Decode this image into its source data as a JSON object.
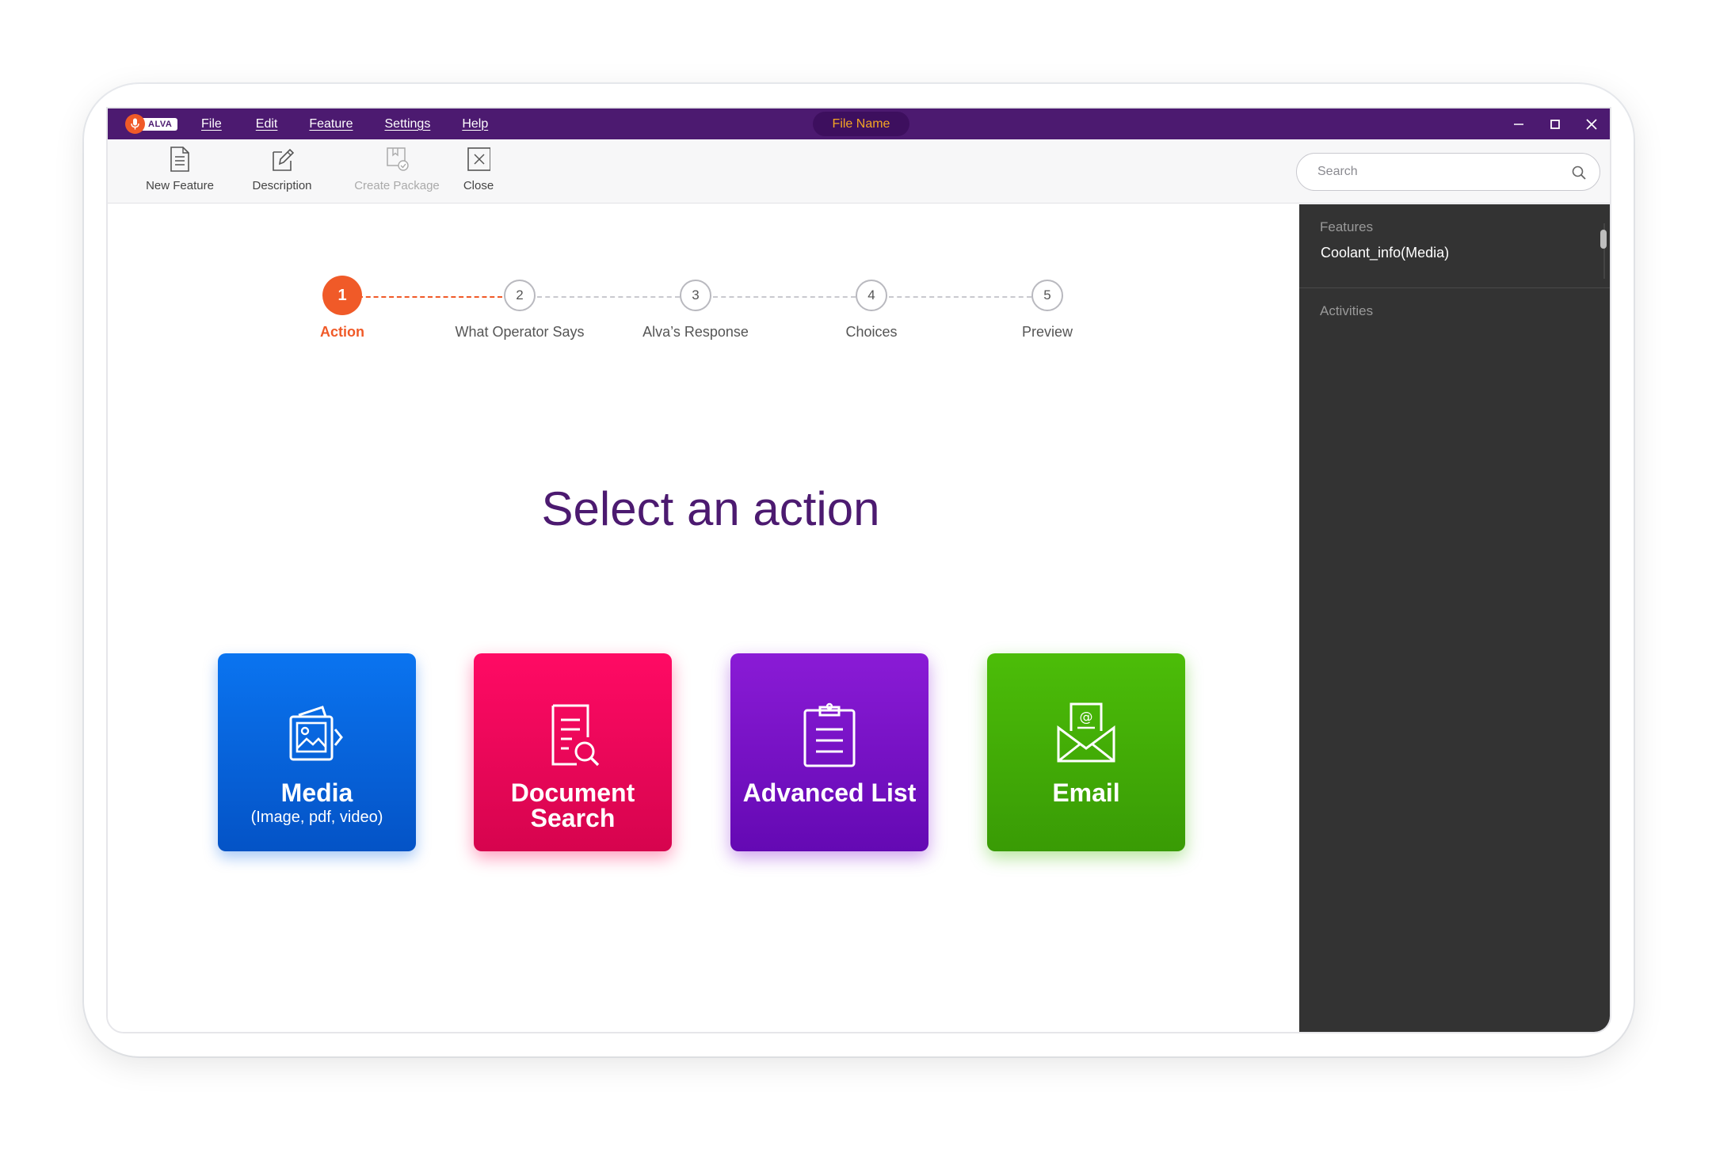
{
  "app": {
    "brand": "ALVA",
    "file_name": "File Name"
  },
  "menu": [
    "File",
    "Edit",
    "Feature",
    "Settings",
    "Help"
  ],
  "toolbar": {
    "new_feature": "New Feature",
    "description": "Description",
    "create_package": "Create Package",
    "close": "Close"
  },
  "search": {
    "placeholder": "Search"
  },
  "sidebar": {
    "features_heading": "Features",
    "feature_item": "Coolant_info(Media)",
    "activities_heading": "Activities"
  },
  "stepper": {
    "current_step": 1,
    "steps": [
      {
        "number": "1",
        "label": "Action"
      },
      {
        "number": "2",
        "label": "What Operator Says"
      },
      {
        "number": "3",
        "label": "Alva’s Response"
      },
      {
        "number": "4",
        "label": "Choices"
      },
      {
        "number": "5",
        "label": "Preview"
      }
    ]
  },
  "main": {
    "heading": "Select an action",
    "cards": [
      {
        "title": "Media",
        "subtitle": "(Image, pdf, video)",
        "icon": "media-icon",
        "color": "#0A74F0"
      },
      {
        "title_line1": "Document",
        "title_line2": "Search",
        "icon": "document-search-icon",
        "color": "#FF0A64"
      },
      {
        "title": "Advanced List",
        "icon": "clipboard-list-icon",
        "color": "#8A1BD6"
      },
      {
        "title": "Email",
        "icon": "email-icon",
        "color": "#4CBD08"
      }
    ]
  },
  "colors": {
    "titlebar": "#4C1A70",
    "accent": "#F05A28",
    "heading": "#4C1A70",
    "sidebar": "#333333"
  }
}
